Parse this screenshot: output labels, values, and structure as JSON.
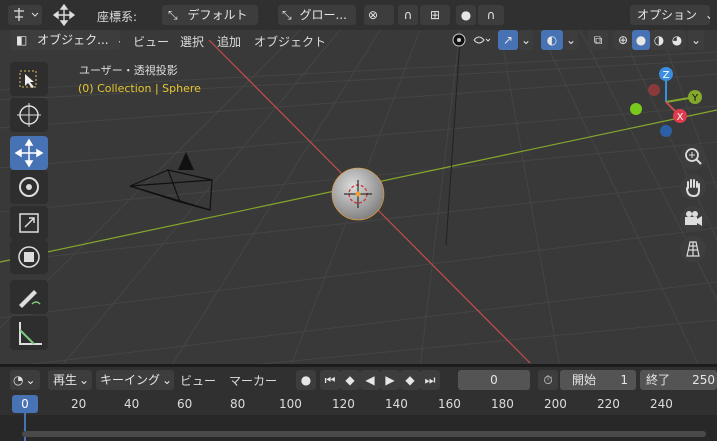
{
  "header": {
    "mode_icon": "editor-type-icon",
    "coord_label": "座標系:",
    "orientation_value": "デフォルト",
    "transform_value": "グロー...",
    "options_label": "オプション"
  },
  "menubar": {
    "object_mode": "オブジェク...",
    "view": "ビュー",
    "select": "選択",
    "add": "追加",
    "object": "オブジェクト"
  },
  "viewport": {
    "view_name": "ユーザー・透視投影",
    "collection_info": "(0) Collection | Sphere",
    "gizmo": {
      "z": "Z",
      "y": "Y",
      "x": "X"
    }
  },
  "colors": {
    "x_axis": "#c44d4d",
    "y_axis": "#84a82c",
    "z_axis": "#3b8ee0",
    "accent": "#4772b3",
    "info_text": "#e6c62f"
  },
  "tools": [
    "select-box-icon",
    "cursor-icon",
    "move-icon",
    "rotate-icon",
    "scale-icon",
    "transform-icon",
    "annotate-icon",
    "measure-icon"
  ],
  "timeline": {
    "playback": "再生",
    "keying": "キーイング",
    "view": "ビュー",
    "marker": "マーカー",
    "current_frame": "0",
    "start_label": "開始",
    "start_value": "1",
    "end_label": "終了",
    "end_value": "250",
    "current_marker": "0",
    "ruler": [
      "20",
      "40",
      "60",
      "80",
      "100",
      "120",
      "140",
      "160",
      "180",
      "200",
      "220",
      "240"
    ]
  }
}
